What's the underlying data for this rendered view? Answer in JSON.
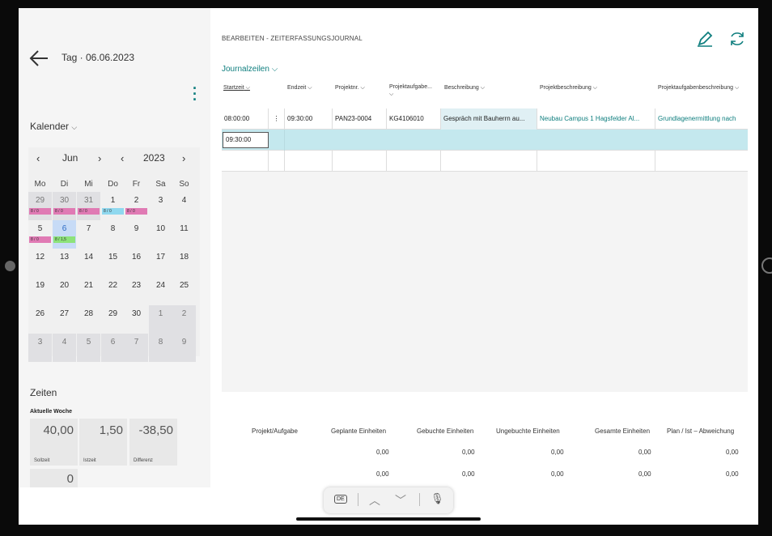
{
  "header": {
    "day_title": "Tag · 06.06.2023"
  },
  "calendar": {
    "label": "Kalender",
    "month": "Jun",
    "year": "2023",
    "weekdays": [
      "Mo",
      "Di",
      "Mi",
      "Do",
      "Fr",
      "Sa",
      "So"
    ],
    "weeks": [
      [
        "29",
        "30",
        "31",
        "1",
        "2",
        "3",
        "4"
      ],
      [
        "5",
        "6",
        "7",
        "8",
        "9",
        "10",
        "11"
      ],
      [
        "12",
        "13",
        "14",
        "15",
        "16",
        "17",
        "18"
      ],
      [
        "19",
        "20",
        "21",
        "22",
        "23",
        "24",
        "25"
      ],
      [
        "26",
        "27",
        "28",
        "29",
        "30",
        "1",
        "2"
      ],
      [
        "3",
        "4",
        "5",
        "6",
        "7",
        "8",
        "9"
      ]
    ],
    "badges": [
      {
        "week": 0,
        "day": 0,
        "text": "8 / 0",
        "color": "#e07ab4"
      },
      {
        "week": 0,
        "day": 1,
        "text": "8 / 0",
        "color": "#e07ab4"
      },
      {
        "week": 0,
        "day": 2,
        "text": "8 / 0",
        "color": "#e07ab4"
      },
      {
        "week": 0,
        "day": 3,
        "text": "8 / 0",
        "color": "#8fd8ef"
      },
      {
        "week": 0,
        "day": 4,
        "text": "8 / 0",
        "color": "#e07ab4"
      },
      {
        "week": 1,
        "day": 0,
        "text": "8 / 0",
        "color": "#e07ab4"
      },
      {
        "week": 1,
        "day": 1,
        "text": "8 / 1,5",
        "color": "#8de37a"
      }
    ]
  },
  "zeiten": {
    "label": "Zeiten",
    "week_label": "Aktuelle Woche",
    "tiles": [
      {
        "value": "40,00",
        "label": "Sollzeit"
      },
      {
        "value": "1,50",
        "label": "Istzeit"
      },
      {
        "value": "-38,50",
        "label": "Differenz"
      },
      {
        "value": "0",
        "label": ""
      }
    ]
  },
  "main": {
    "breadcrumb": "BEARBEITEN - ZEITERFASSUNGSJOURNAL",
    "lines_label": "Journalzeilen",
    "columns": [
      "Startzeit",
      "Endzeit",
      "Projektnr.",
      "Projektaufgabe...",
      "Beschreibung",
      "Projektbeschreibung",
      "Projektaufgabenbeschreibung"
    ],
    "rows": [
      {
        "start": "08:00:00",
        "end": "09:30:00",
        "proj": "PAN23-0004",
        "task": "KG4106010",
        "desc": "Gespräch mit Bauherrn au...",
        "projdesc": "Neubau Campus 1 Hagsfelder Al...",
        "taskdesc": "Grundlagenermittlung nach"
      }
    ],
    "edit_value": "09:30:00"
  },
  "summary": {
    "headers": [
      "Projekt/Aufgabe",
      "Geplante Einheiten",
      "Gebuchte Einheiten",
      "Ungebuchte Einheiten",
      "Gesamte Einheiten",
      "Plan / Ist – Abweichung"
    ],
    "rows": [
      [
        "0,00",
        "0,00",
        "0,00",
        "0,00",
        "0,00"
      ],
      [
        "0,00",
        "0,00",
        "0,00",
        "0,00",
        "0,00"
      ]
    ]
  },
  "toolbar": {
    "lang": "DE"
  },
  "colors": {
    "accent": "#0e7e7e",
    "pink": "#e07ab4",
    "green": "#8de37a",
    "blue": "#8fd8ef",
    "selected_row": "#c4e8ee"
  }
}
